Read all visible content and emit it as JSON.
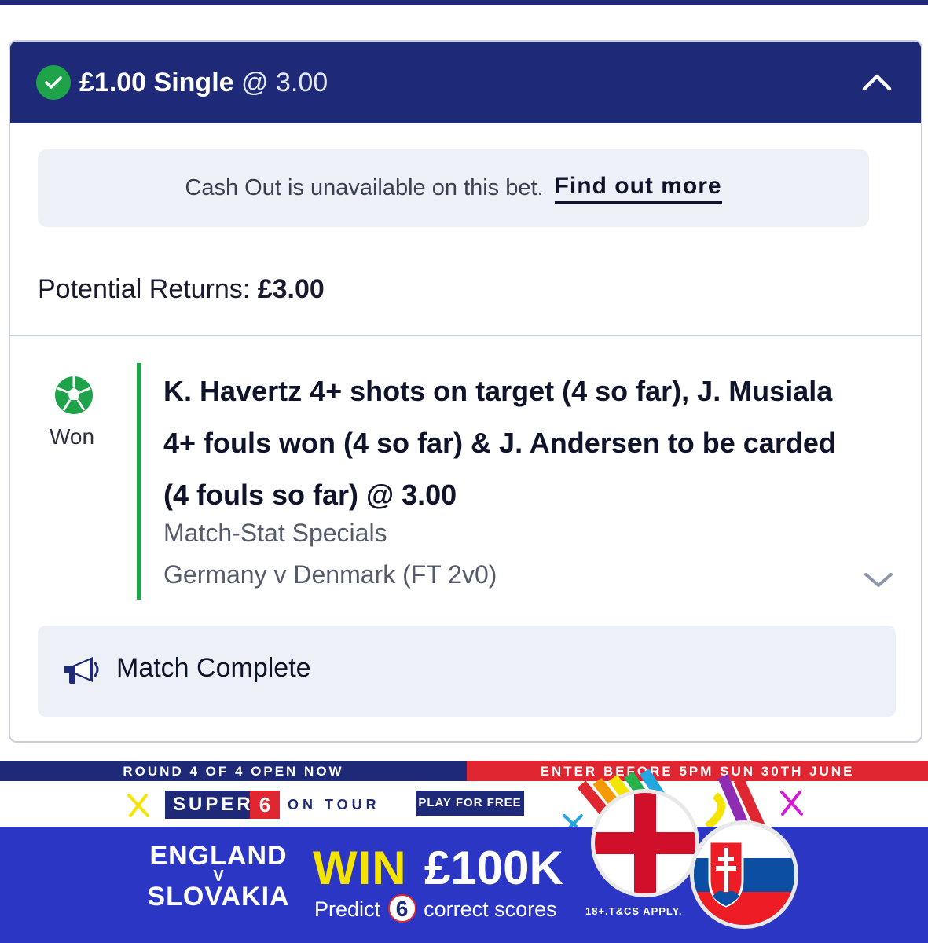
{
  "bet": {
    "stake": "£1.00 Single",
    "odds": "@ 3.00",
    "cashout_message": "Cash Out is unavailable on this bet.",
    "find_out_more": "Find out more",
    "returns_label": "Potential Returns:",
    "returns_value": "£3.00",
    "result": "Won",
    "selection": "K. Havertz 4+ shots on target (4 so far), J. Musiala 4+ fouls won (4 so far) & J. Andersen to be carded (4 fouls so far) @ 3.00",
    "market": "Match-Stat Specials",
    "event": "Germany v Denmark (FT 2v0)",
    "status": "Match Complete"
  },
  "promo": {
    "round": "ROUND 4 OF 4 OPEN NOW",
    "deadline": "ENTER BEFORE 5PM SUN 30TH JUNE",
    "brand": "SUPER",
    "brand_number": "6",
    "on_tour": "ON TOUR",
    "play_free": "PLAY FOR FREE",
    "team_home": "ENGLAND",
    "versus": "V",
    "team_away": "SLOVAKIA",
    "win": "WIN",
    "prize": "£100K",
    "predict_prefix": "Predict",
    "predict_number": "6",
    "predict_suffix": "correct scores",
    "terms": "18+.T&CS APPLY."
  },
  "colors": {
    "navy": "#1e2a78",
    "success_green": "#1fa34a",
    "promo_blue": "#2b37c4",
    "promo_red": "#e02631",
    "promo_yellow": "#f5e400"
  }
}
